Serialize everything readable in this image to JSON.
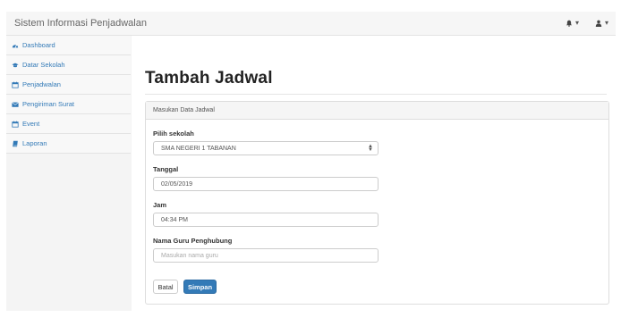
{
  "navbar": {
    "brand": "Sistem Informasi Penjadwalan",
    "alerts_icon": "bell-icon",
    "user_icon": "user-icon",
    "caret": "▾"
  },
  "sidebar": {
    "items": [
      {
        "label": "Dashboard",
        "icon": "dashboard-icon"
      },
      {
        "label": "Datar Sekolah",
        "icon": "graduation-cap-icon"
      },
      {
        "label": "Penjadwalan",
        "icon": "calendar-icon"
      },
      {
        "label": "Pengiriman Surat",
        "icon": "envelope-icon"
      },
      {
        "label": "Event",
        "icon": "calendar-icon"
      },
      {
        "label": "Laporan",
        "icon": "book-icon"
      }
    ]
  },
  "main": {
    "title": "Tambah Jadwal",
    "panel_heading": "Masukan Data Jadwal",
    "form": {
      "school_label": "Pilih sekolah",
      "school_value": "SMA NEGERI 1 TABANAN",
      "date_label": "Tanggal",
      "date_value": "02/05/2019",
      "time_label": "Jam",
      "time_value": "04:34 PM",
      "teacher_label": "Nama Guru Penghubung",
      "teacher_placeholder": "Masukan nama guru",
      "cancel_label": "Batal",
      "submit_label": "Simpan"
    }
  },
  "colors": {
    "link": "#337ab7",
    "primary": "#337ab7"
  }
}
